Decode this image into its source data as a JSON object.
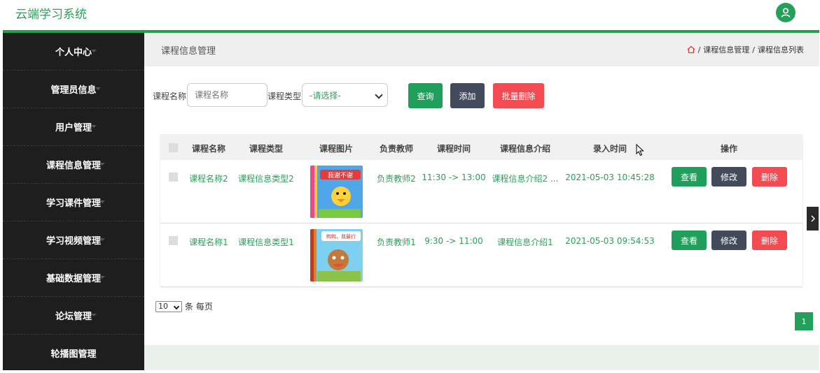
{
  "app": {
    "title": "云端学习系统"
  },
  "sidebar": {
    "items": [
      {
        "label": "个人中心"
      },
      {
        "label": "管理员信息"
      },
      {
        "label": "用户管理"
      },
      {
        "label": "课程信息管理"
      },
      {
        "label": "学习课件管理"
      },
      {
        "label": "学习视频管理"
      },
      {
        "label": "基础数据管理"
      },
      {
        "label": "论坛管理"
      },
      {
        "label": "轮播图管理"
      }
    ]
  },
  "header": {
    "title": "课程信息管理",
    "breadcrumb": {
      "sep": "/",
      "level1": "课程信息管理",
      "level2": "课程信息列表"
    }
  },
  "search": {
    "name_label": "课程名称",
    "name_placeholder": "课程名称",
    "type_label": "课程类型",
    "type_selected": "-请选择-",
    "query_button": "查询",
    "add_button": "添加",
    "batch_delete_button": "批量删除"
  },
  "table": {
    "headers": [
      "课程名称",
      "课程类型",
      "课程图片",
      "负责教师",
      "课程时间",
      "课程信息介绍",
      "录入时间",
      "操作"
    ],
    "rows": [
      {
        "name": "课程名称2",
        "type": "课程信息类型2",
        "teacher": "负责教师2",
        "time": "11:30 -> 13:00",
        "intro": "课程信息介绍2 ...",
        "created": "2021-05-03 10:45:28",
        "image_text": "我谢不谢"
      },
      {
        "name": "课程名称1",
        "type": "课程信息类型1",
        "teacher": "负责教师1",
        "time": "9:30 -> 11:00",
        "intro": "课程信息介绍1",
        "created": "2021-05-03 09:54:53",
        "image_text": "鸭鸭，我最行"
      }
    ],
    "actions": {
      "view": "查看",
      "edit": "修改",
      "delete": "删除"
    }
  },
  "pagination": {
    "page_size": "10",
    "suffix": "条 每页",
    "current_page": "1"
  },
  "colors": {
    "brand": "#2e9e5a",
    "query_btn": "#1f9e5c",
    "add_btn": "#434a5c",
    "delete_btn": "#f44a52",
    "sidebar_bg": "#1e1e1e"
  },
  "icons": {
    "avatar": "user-icon",
    "home": "home-icon",
    "toggle": "chevron-right-icon"
  }
}
